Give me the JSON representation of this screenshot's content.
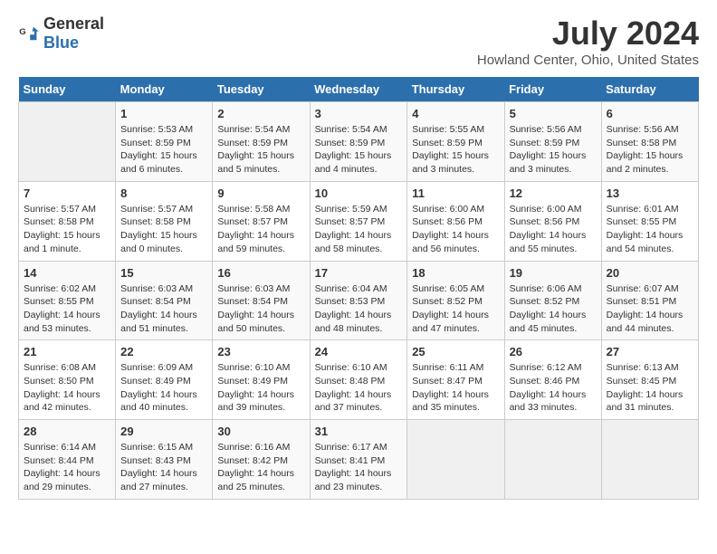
{
  "header": {
    "logo_general": "General",
    "logo_blue": "Blue",
    "title": "July 2024",
    "subtitle": "Howland Center, Ohio, United States"
  },
  "days_of_week": [
    "Sunday",
    "Monday",
    "Tuesday",
    "Wednesday",
    "Thursday",
    "Friday",
    "Saturday"
  ],
  "weeks": [
    [
      {
        "day": "",
        "info": ""
      },
      {
        "day": "1",
        "info": "Sunrise: 5:53 AM\nSunset: 8:59 PM\nDaylight: 15 hours\nand 6 minutes."
      },
      {
        "day": "2",
        "info": "Sunrise: 5:54 AM\nSunset: 8:59 PM\nDaylight: 15 hours\nand 5 minutes."
      },
      {
        "day": "3",
        "info": "Sunrise: 5:54 AM\nSunset: 8:59 PM\nDaylight: 15 hours\nand 4 minutes."
      },
      {
        "day": "4",
        "info": "Sunrise: 5:55 AM\nSunset: 8:59 PM\nDaylight: 15 hours\nand 3 minutes."
      },
      {
        "day": "5",
        "info": "Sunrise: 5:56 AM\nSunset: 8:59 PM\nDaylight: 15 hours\nand 3 minutes."
      },
      {
        "day": "6",
        "info": "Sunrise: 5:56 AM\nSunset: 8:58 PM\nDaylight: 15 hours\nand 2 minutes."
      }
    ],
    [
      {
        "day": "7",
        "info": "Sunrise: 5:57 AM\nSunset: 8:58 PM\nDaylight: 15 hours\nand 1 minute."
      },
      {
        "day": "8",
        "info": "Sunrise: 5:57 AM\nSunset: 8:58 PM\nDaylight: 15 hours\nand 0 minutes."
      },
      {
        "day": "9",
        "info": "Sunrise: 5:58 AM\nSunset: 8:57 PM\nDaylight: 14 hours\nand 59 minutes."
      },
      {
        "day": "10",
        "info": "Sunrise: 5:59 AM\nSunset: 8:57 PM\nDaylight: 14 hours\nand 58 minutes."
      },
      {
        "day": "11",
        "info": "Sunrise: 6:00 AM\nSunset: 8:56 PM\nDaylight: 14 hours\nand 56 minutes."
      },
      {
        "day": "12",
        "info": "Sunrise: 6:00 AM\nSunset: 8:56 PM\nDaylight: 14 hours\nand 55 minutes."
      },
      {
        "day": "13",
        "info": "Sunrise: 6:01 AM\nSunset: 8:55 PM\nDaylight: 14 hours\nand 54 minutes."
      }
    ],
    [
      {
        "day": "14",
        "info": "Sunrise: 6:02 AM\nSunset: 8:55 PM\nDaylight: 14 hours\nand 53 minutes."
      },
      {
        "day": "15",
        "info": "Sunrise: 6:03 AM\nSunset: 8:54 PM\nDaylight: 14 hours\nand 51 minutes."
      },
      {
        "day": "16",
        "info": "Sunrise: 6:03 AM\nSunset: 8:54 PM\nDaylight: 14 hours\nand 50 minutes."
      },
      {
        "day": "17",
        "info": "Sunrise: 6:04 AM\nSunset: 8:53 PM\nDaylight: 14 hours\nand 48 minutes."
      },
      {
        "day": "18",
        "info": "Sunrise: 6:05 AM\nSunset: 8:52 PM\nDaylight: 14 hours\nand 47 minutes."
      },
      {
        "day": "19",
        "info": "Sunrise: 6:06 AM\nSunset: 8:52 PM\nDaylight: 14 hours\nand 45 minutes."
      },
      {
        "day": "20",
        "info": "Sunrise: 6:07 AM\nSunset: 8:51 PM\nDaylight: 14 hours\nand 44 minutes."
      }
    ],
    [
      {
        "day": "21",
        "info": "Sunrise: 6:08 AM\nSunset: 8:50 PM\nDaylight: 14 hours\nand 42 minutes."
      },
      {
        "day": "22",
        "info": "Sunrise: 6:09 AM\nSunset: 8:49 PM\nDaylight: 14 hours\nand 40 minutes."
      },
      {
        "day": "23",
        "info": "Sunrise: 6:10 AM\nSunset: 8:49 PM\nDaylight: 14 hours\nand 39 minutes."
      },
      {
        "day": "24",
        "info": "Sunrise: 6:10 AM\nSunset: 8:48 PM\nDaylight: 14 hours\nand 37 minutes."
      },
      {
        "day": "25",
        "info": "Sunrise: 6:11 AM\nSunset: 8:47 PM\nDaylight: 14 hours\nand 35 minutes."
      },
      {
        "day": "26",
        "info": "Sunrise: 6:12 AM\nSunset: 8:46 PM\nDaylight: 14 hours\nand 33 minutes."
      },
      {
        "day": "27",
        "info": "Sunrise: 6:13 AM\nSunset: 8:45 PM\nDaylight: 14 hours\nand 31 minutes."
      }
    ],
    [
      {
        "day": "28",
        "info": "Sunrise: 6:14 AM\nSunset: 8:44 PM\nDaylight: 14 hours\nand 29 minutes."
      },
      {
        "day": "29",
        "info": "Sunrise: 6:15 AM\nSunset: 8:43 PM\nDaylight: 14 hours\nand 27 minutes."
      },
      {
        "day": "30",
        "info": "Sunrise: 6:16 AM\nSunset: 8:42 PM\nDaylight: 14 hours\nand 25 minutes."
      },
      {
        "day": "31",
        "info": "Sunrise: 6:17 AM\nSunset: 8:41 PM\nDaylight: 14 hours\nand 23 minutes."
      },
      {
        "day": "",
        "info": ""
      },
      {
        "day": "",
        "info": ""
      },
      {
        "day": "",
        "info": ""
      }
    ]
  ]
}
